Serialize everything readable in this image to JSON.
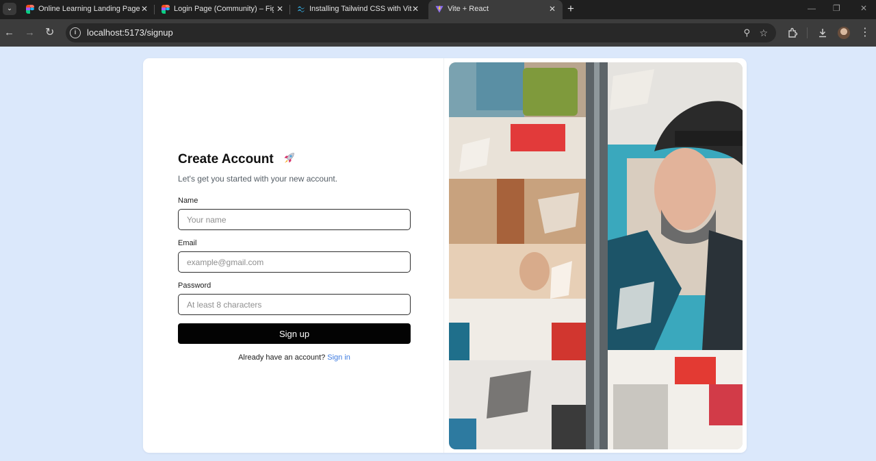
{
  "browser": {
    "tabs": [
      {
        "title": "Online Learning Landing Page (",
        "icon": "figma-icon",
        "active": false
      },
      {
        "title": "Login Page (Community) – Figm",
        "icon": "figma-icon",
        "active": false
      },
      {
        "title": "Installing Tailwind CSS with Vite",
        "icon": "tailwind-icon",
        "active": false
      },
      {
        "title": "Vite + React",
        "icon": "vite-icon",
        "active": true
      }
    ],
    "new_tab_label": "+",
    "url": "localhost:5173/signup"
  },
  "signup": {
    "title": "Create Account",
    "subtitle": "Let's get you started with your new account.",
    "name_label": "Name",
    "name_placeholder": "Your name",
    "email_label": "Email",
    "email_placeholder": "example@gmail.com",
    "password_label": "Password",
    "password_placeholder": "At least 8 characters",
    "submit_label": "Sign up",
    "signin_prompt": "Already have an account?",
    "signin_link": "Sign in"
  },
  "colors": {
    "page_background": "#dbe8fb",
    "button": "#030303",
    "link": "#3d7be0"
  }
}
